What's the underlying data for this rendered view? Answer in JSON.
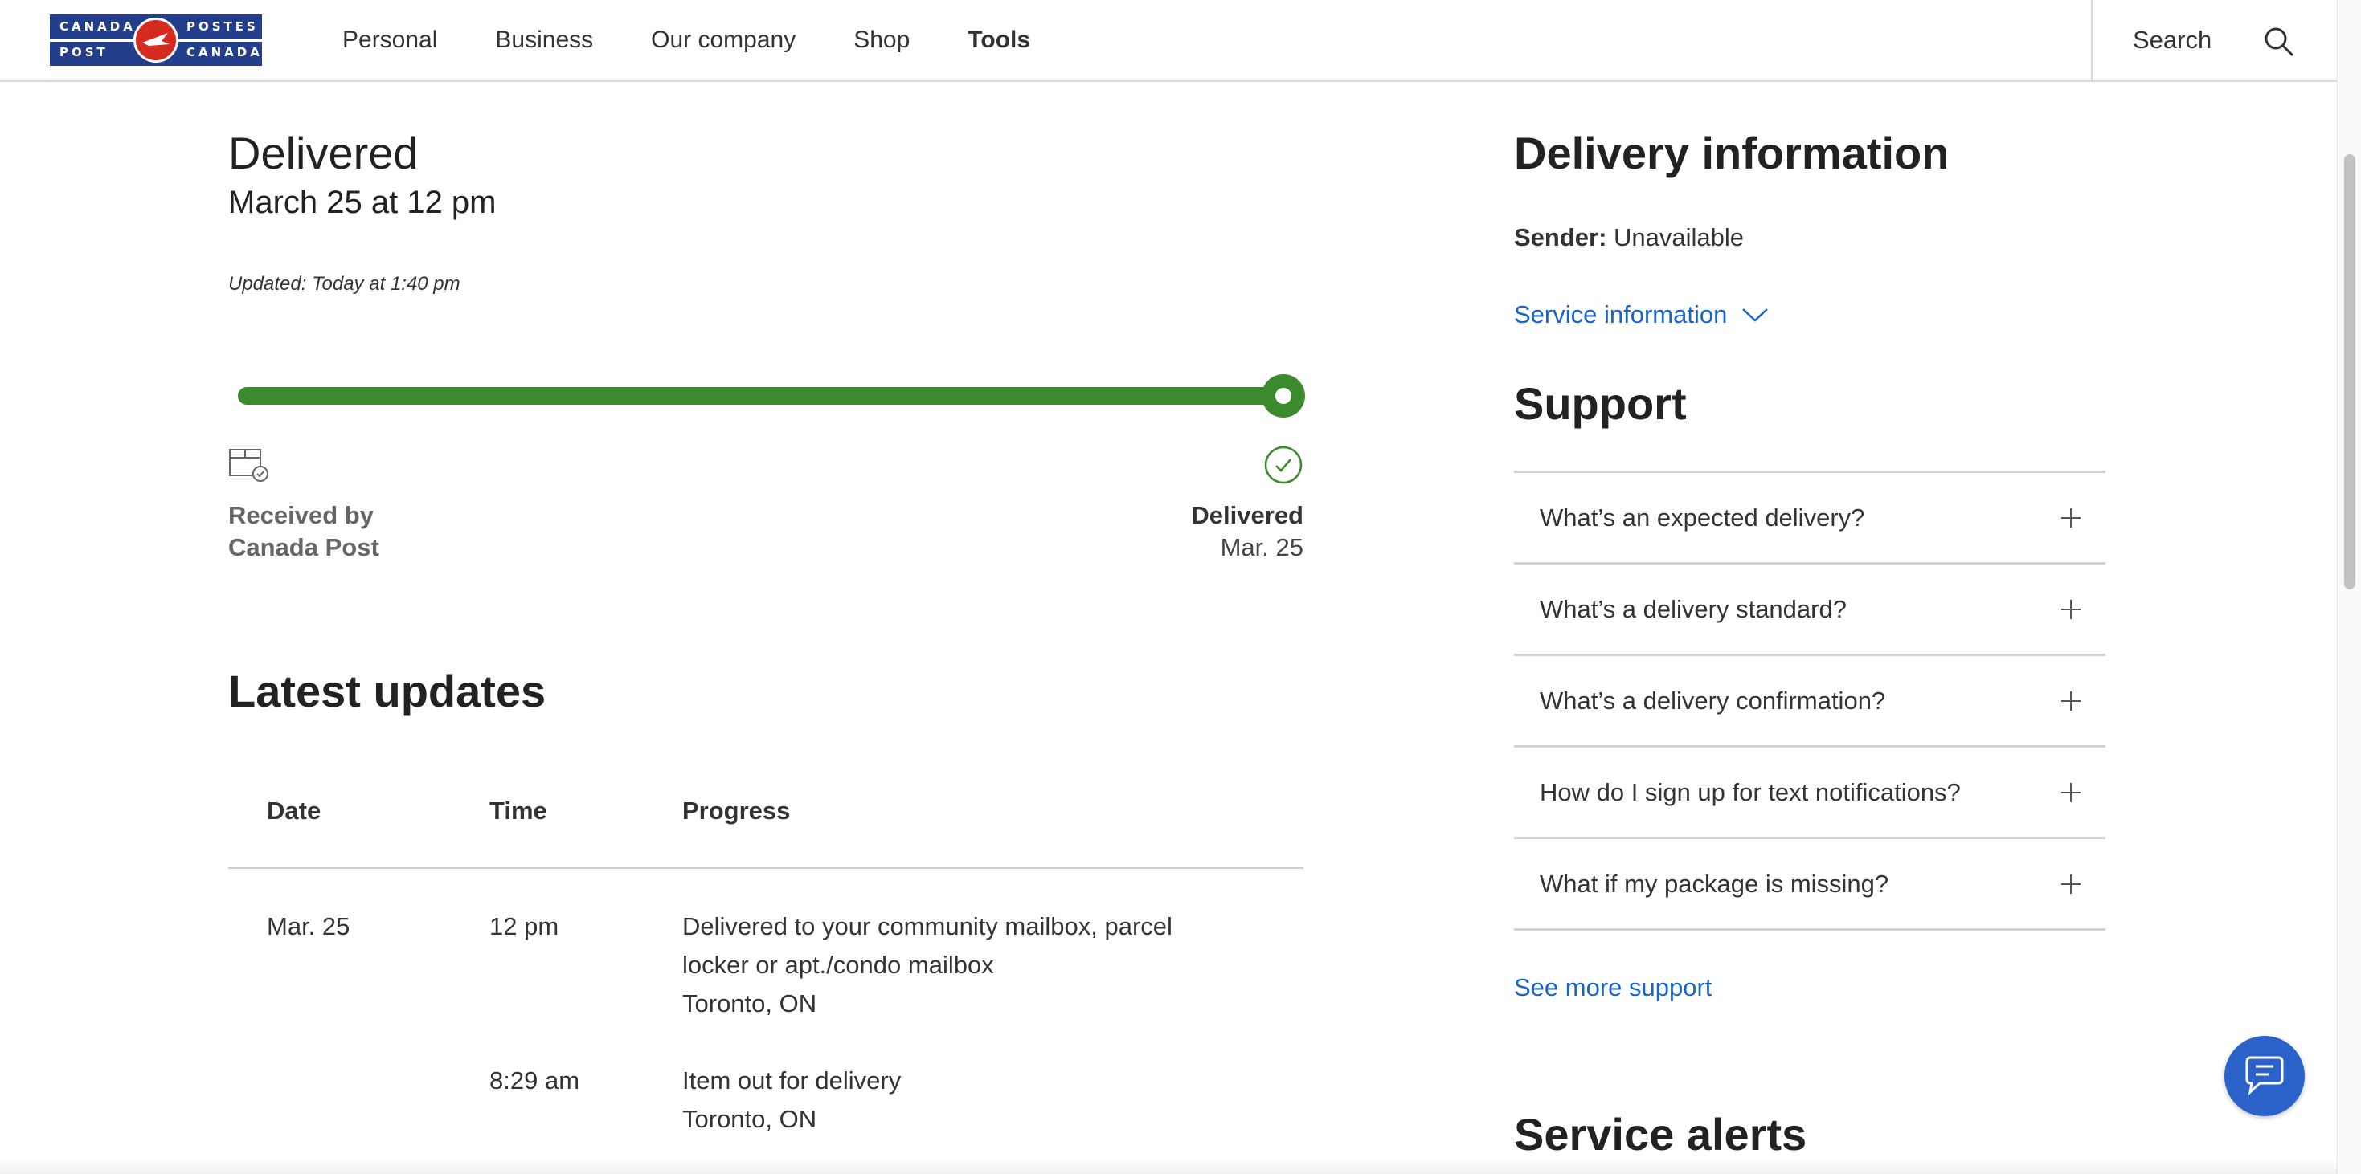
{
  "header": {
    "logo": {
      "top_left": "CANADA",
      "top_right": "POSTES",
      "bottom_left": "POST",
      "bottom_right": "CANADA"
    },
    "nav": [
      "Personal",
      "Business",
      "Our company",
      "Shop",
      "Tools"
    ],
    "search_label": "Search"
  },
  "tracking": {
    "status": "Delivered",
    "status_date": "March 25 at 12 pm",
    "updated": "Updated: Today at 1:40 pm",
    "progress_fraction": 1.0,
    "start_label": "Received by Canada Post",
    "end_label": "Delivered",
    "end_date": "Mar. 25",
    "progress_color": "#3c8a2e"
  },
  "updates": {
    "title": "Latest updates",
    "columns": [
      "Date",
      "Time",
      "Progress"
    ],
    "rows": [
      {
        "date": "Mar. 25",
        "time": "12 pm",
        "progress_line1": "Delivered to your community mailbox, parcel",
        "progress_line2": "locker or apt./condo mailbox",
        "location": "Toronto, ON"
      },
      {
        "date": "",
        "time": "8:29 am",
        "progress_line1": "Item out for delivery",
        "progress_line2": "",
        "location": "Toronto, ON"
      }
    ]
  },
  "delivery_info": {
    "title": "Delivery information",
    "sender_label": "Sender:",
    "sender_value": "Unavailable",
    "service_link": "Service information"
  },
  "support": {
    "title": "Support",
    "questions": [
      "What’s an expected delivery?",
      "What’s a delivery standard?",
      "What’s a delivery confirmation?",
      "How do I sign up for text notifications?",
      "What if my package is missing?"
    ],
    "see_more": "See more support"
  },
  "service_alerts": {
    "title": "Service alerts"
  },
  "colors": {
    "link": "#1a65c4",
    "brand_blue": "#233e8b",
    "brand_red": "#d52b1e",
    "chat_button": "#2a62c9"
  }
}
